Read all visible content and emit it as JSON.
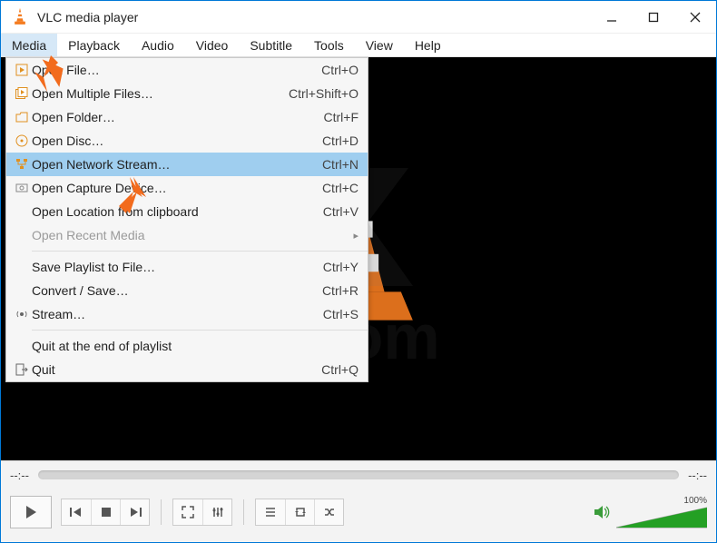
{
  "window": {
    "title": "VLC media player"
  },
  "menus": [
    "Media",
    "Playback",
    "Audio",
    "Video",
    "Subtitle",
    "Tools",
    "View",
    "Help"
  ],
  "media_menu": {
    "open_file": {
      "label": "Open File…",
      "short": "Ctrl+O"
    },
    "open_multiple": {
      "label": "Open Multiple Files…",
      "short": "Ctrl+Shift+O"
    },
    "open_folder": {
      "label": "Open Folder…",
      "short": "Ctrl+F"
    },
    "open_disc": {
      "label": "Open Disc…",
      "short": "Ctrl+D"
    },
    "open_network": {
      "label": "Open Network Stream…",
      "short": "Ctrl+N"
    },
    "open_capture": {
      "label": "Open Capture Device…",
      "short": "Ctrl+C"
    },
    "open_clipboard": {
      "label": "Open Location from clipboard",
      "short": "Ctrl+V"
    },
    "open_recent": {
      "label": "Open Recent Media"
    },
    "save_playlist": {
      "label": "Save Playlist to File…",
      "short": "Ctrl+Y"
    },
    "convert": {
      "label": "Convert / Save…",
      "short": "Ctrl+R"
    },
    "stream": {
      "label": "Stream…",
      "short": "Ctrl+S"
    },
    "quit_end": {
      "label": "Quit at the end of playlist"
    },
    "quit": {
      "label": "Quit",
      "short": "Ctrl+Q"
    }
  },
  "time": {
    "elapsed": "--:--",
    "remaining": "--:--"
  },
  "volume": {
    "percent": "100%"
  }
}
